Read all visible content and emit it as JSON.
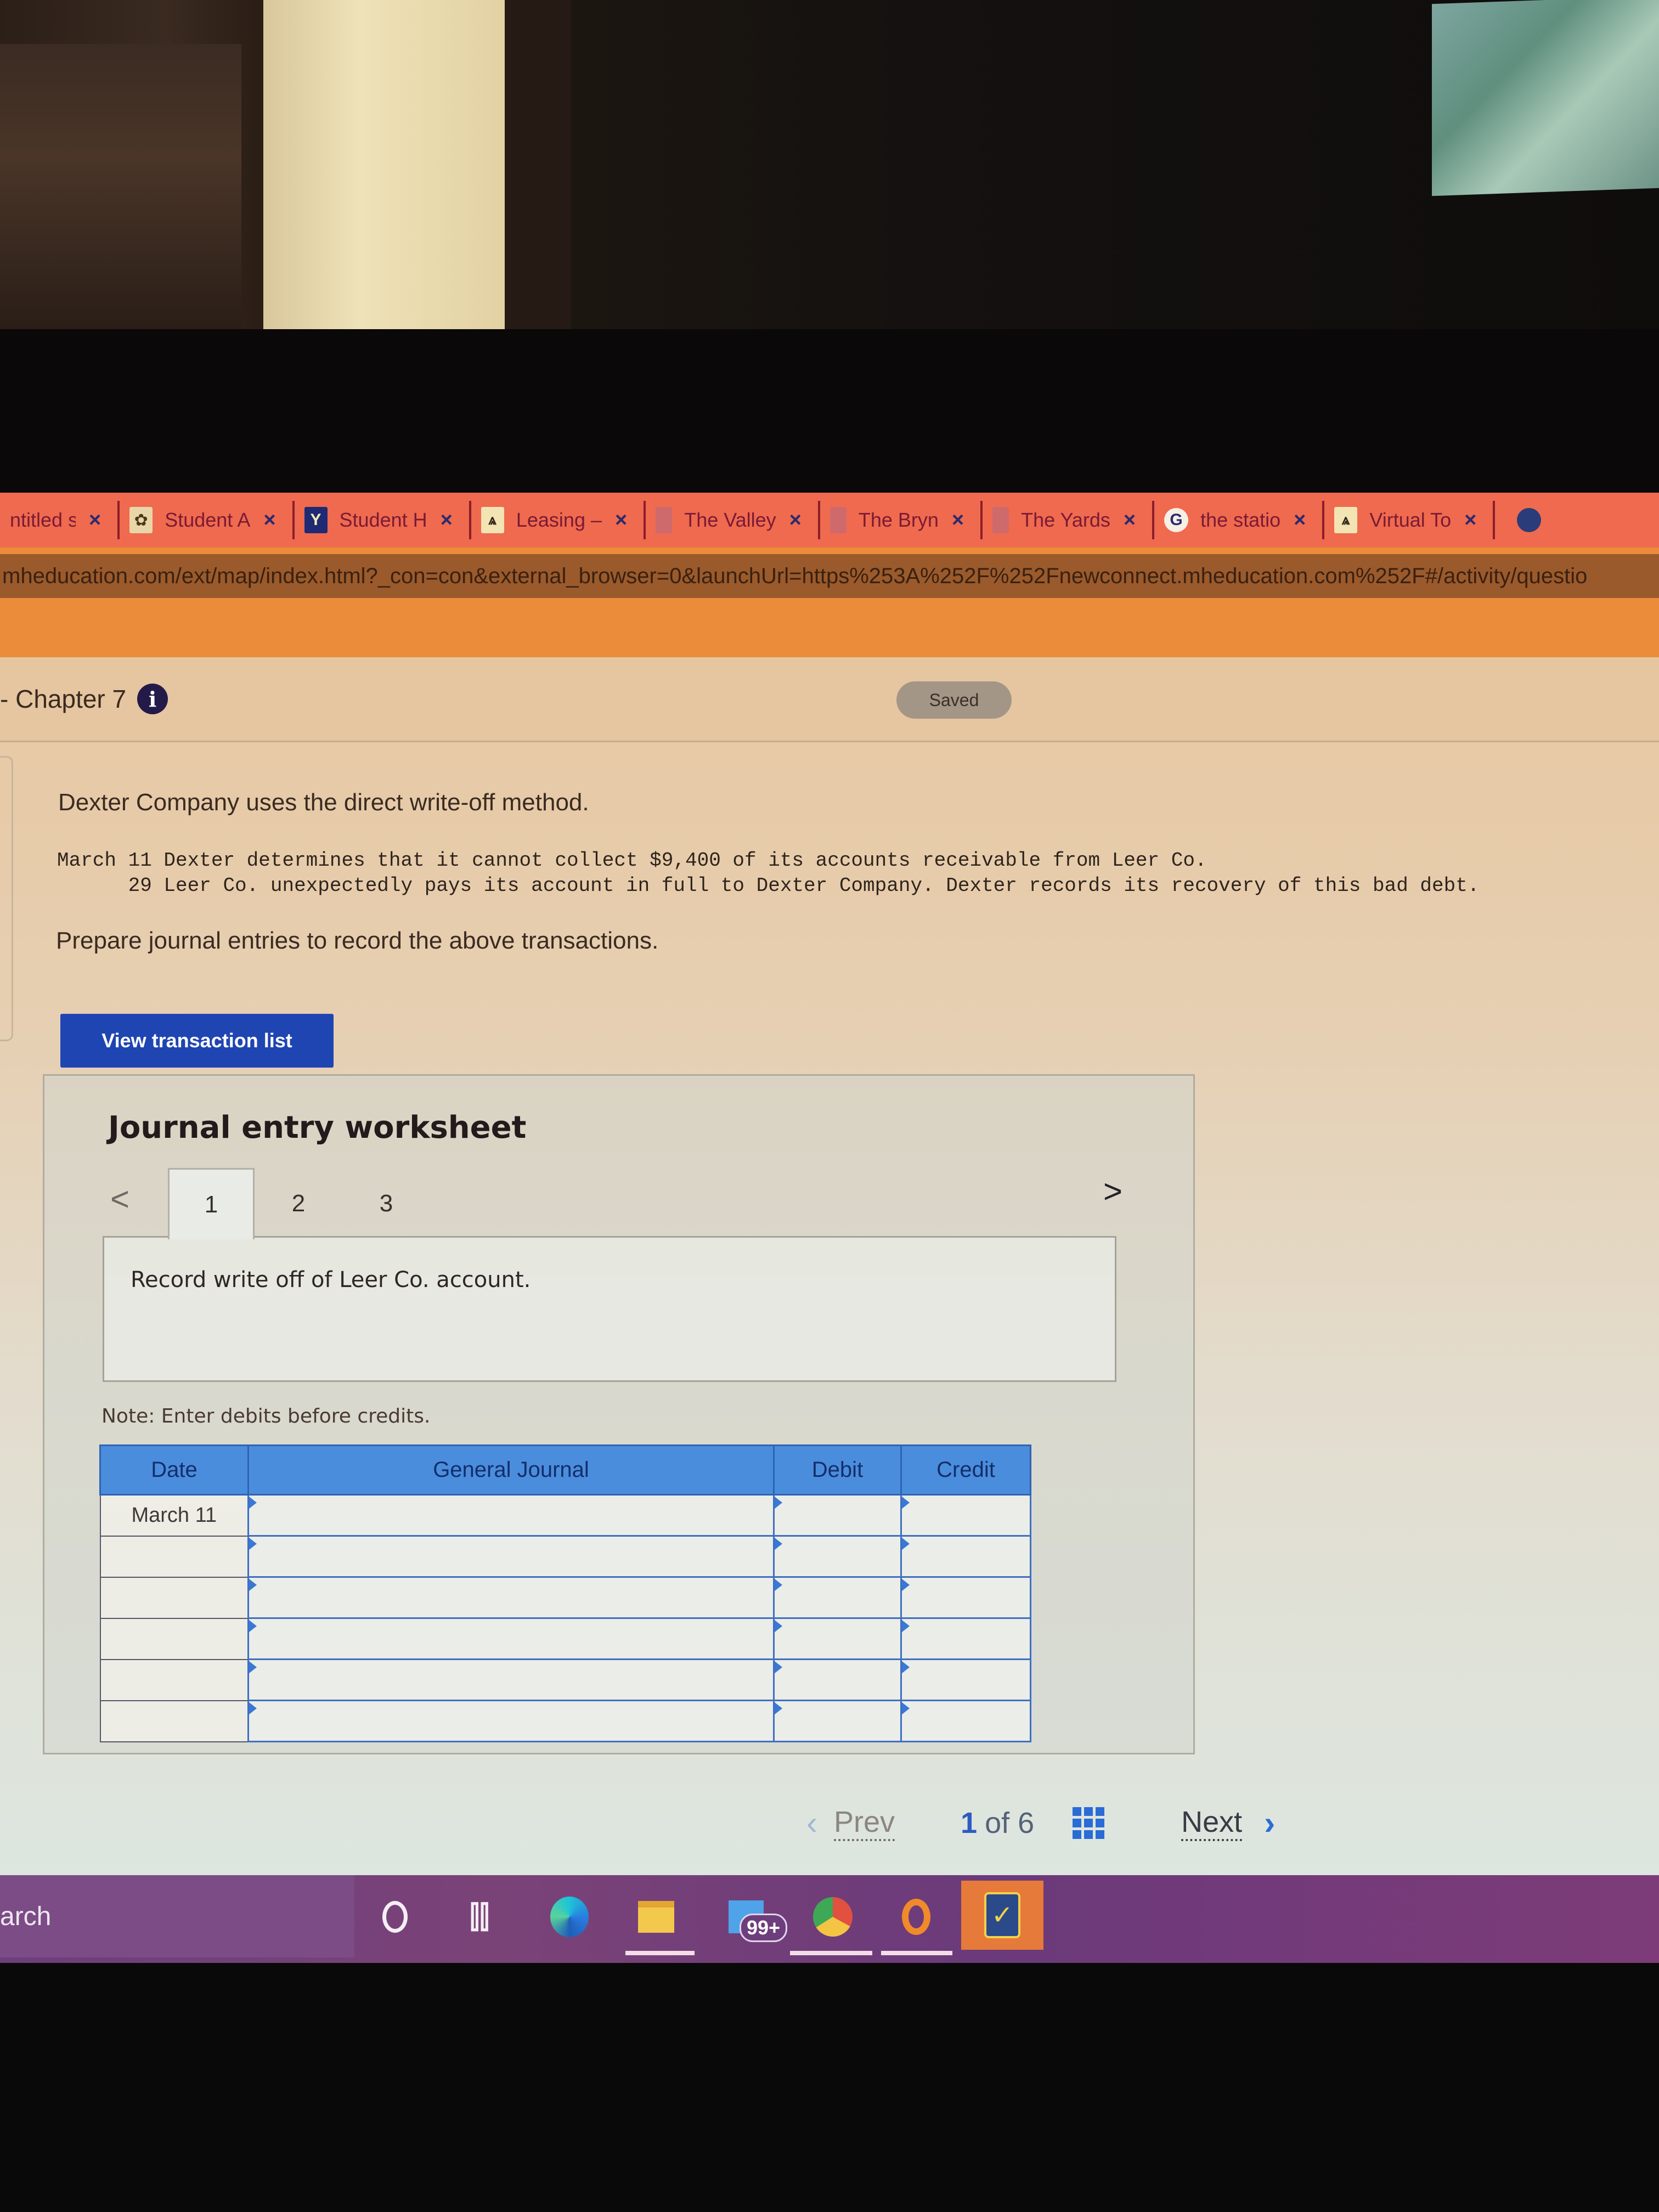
{
  "browser": {
    "tabs": [
      {
        "icon": "document-icon",
        "label": "ntitled s",
        "close": "×"
      },
      {
        "icon": "tree-logo-icon",
        "label": "Student A",
        "close": "×"
      },
      {
        "icon": "y-logo-icon",
        "label": "Student H",
        "close": "×"
      },
      {
        "icon": "valley-logo-icon",
        "label": "Leasing –",
        "close": "×"
      },
      {
        "icon": "blank-favicon-icon",
        "label": "The Valley",
        "close": "×"
      },
      {
        "icon": "blank-favicon-icon",
        "label": "The Bryn",
        "close": "×"
      },
      {
        "icon": "blank-favicon-icon",
        "label": "The Yards",
        "close": "×"
      },
      {
        "icon": "google-icon",
        "label": "the statio",
        "close": "×"
      },
      {
        "icon": "valley-logo-icon",
        "label": "Virtual To",
        "close": "×"
      }
    ],
    "tab_favicon_glyphs": {
      "tree": "✿",
      "y": "Y",
      "valley": "⩓",
      "google": "G"
    },
    "url": "mheducation.com/ext/map/index.html?_con=con&external_browser=0&launchUrl=https%253A%252F%252Fnewconnect.mheducation.com%252F#/activity/questio"
  },
  "header": {
    "chapter": "- Chapter 7",
    "info_glyph": "i",
    "status_badge": "Saved"
  },
  "question": {
    "intro": "Dexter Company uses the direct write-off method.",
    "transactions": [
      "March 11 Dexter determines that it cannot collect $9,400 of its accounts receivable from Leer Co.",
      "      29 Leer Co. unexpectedly pays its account in full to Dexter Company. Dexter records its recovery of this bad debt."
    ],
    "instruction": "Prepare journal entries to record the above transactions.",
    "view_transactions_button": "View transaction list"
  },
  "worksheet": {
    "title": "Journal entry worksheet",
    "prev_glyph": "<",
    "next_glyph": ">",
    "tabs": [
      "1",
      "2",
      "3"
    ],
    "active_tab": "1",
    "description": "Record write off of Leer Co. account.",
    "note": "Note: Enter debits before credits.",
    "table": {
      "columns": [
        "Date",
        "General Journal",
        "Debit",
        "Credit"
      ],
      "rows": [
        {
          "date": "March 11",
          "account": "",
          "debit": "",
          "credit": ""
        },
        {
          "date": "",
          "account": "",
          "debit": "",
          "credit": ""
        },
        {
          "date": "",
          "account": "",
          "debit": "",
          "credit": ""
        },
        {
          "date": "",
          "account": "",
          "debit": "",
          "credit": ""
        },
        {
          "date": "",
          "account": "",
          "debit": "",
          "credit": ""
        },
        {
          "date": "",
          "account": "",
          "debit": "",
          "credit": ""
        }
      ]
    }
  },
  "pagination": {
    "prev_arrow": "‹",
    "prev_label": "Prev",
    "current": "1",
    "of_total": "of 6",
    "next_label": "Next",
    "next_arrow": "›"
  },
  "taskbar": {
    "search_label": "arch",
    "task_view_glyph": "⫿⫿",
    "mail_badge": "99+",
    "norton_glyph": "✓"
  },
  "colors": {
    "tab_bar": "#ef6a4e",
    "primary_button": "#1f45b2",
    "table_header": "#4a8ddd",
    "link_blue": "#2a6cd6"
  }
}
